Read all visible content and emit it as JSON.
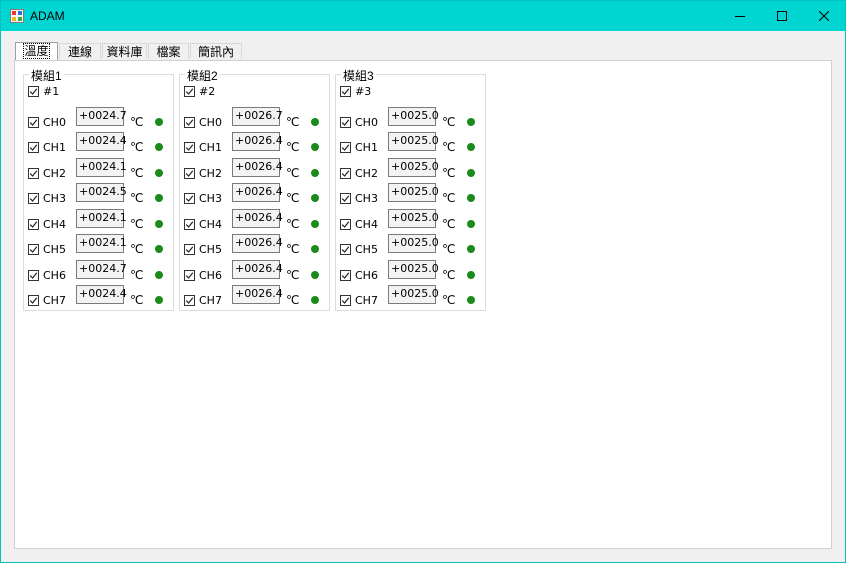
{
  "window": {
    "title": "ADAM",
    "title_bar_color": "#00d5d2",
    "controls": [
      "minimize-icon",
      "maximize-icon",
      "close-icon"
    ]
  },
  "tabs": [
    {
      "label": "溫度",
      "active": true
    },
    {
      "label": "連線",
      "active": false
    },
    {
      "label": "資料庫",
      "active": false
    },
    {
      "label": "檔案",
      "active": false
    },
    {
      "label": "簡訊內容",
      "active": false
    }
  ],
  "status_color": "#1a8a1a",
  "groups": [
    {
      "title": "模組1",
      "module_label": "#1",
      "unit": "℃",
      "channels": [
        {
          "name": "CH0",
          "value": "+0024.7"
        },
        {
          "name": "CH1",
          "value": "+0024.4"
        },
        {
          "name": "CH2",
          "value": "+0024.1"
        },
        {
          "name": "CH3",
          "value": "+0024.5"
        },
        {
          "name": "CH4",
          "value": "+0024.1"
        },
        {
          "name": "CH5",
          "value": "+0024.1"
        },
        {
          "name": "CH6",
          "value": "+0024.7"
        },
        {
          "name": "CH7",
          "value": "+0024.4"
        }
      ]
    },
    {
      "title": "模組2",
      "module_label": "#2",
      "unit": "℃",
      "channels": [
        {
          "name": "CH0",
          "value": "+0026.7"
        },
        {
          "name": "CH1",
          "value": "+0026.4"
        },
        {
          "name": "CH2",
          "value": "+0026.4"
        },
        {
          "name": "CH3",
          "value": "+0026.4"
        },
        {
          "name": "CH4",
          "value": "+0026.4"
        },
        {
          "name": "CH5",
          "value": "+0026.4"
        },
        {
          "name": "CH6",
          "value": "+0026.4"
        },
        {
          "name": "CH7",
          "value": "+0026.4"
        }
      ]
    },
    {
      "title": "模組3",
      "module_label": "#3",
      "unit": "℃",
      "channels": [
        {
          "name": "CH0",
          "value": "+0025.0"
        },
        {
          "name": "CH1",
          "value": "+0025.0"
        },
        {
          "name": "CH2",
          "value": "+0025.0"
        },
        {
          "name": "CH3",
          "value": "+0025.0"
        },
        {
          "name": "CH4",
          "value": "+0025.0"
        },
        {
          "name": "CH5",
          "value": "+0025.0"
        },
        {
          "name": "CH6",
          "value": "+0025.0"
        },
        {
          "name": "CH7",
          "value": "+0025.0"
        }
      ]
    }
  ]
}
